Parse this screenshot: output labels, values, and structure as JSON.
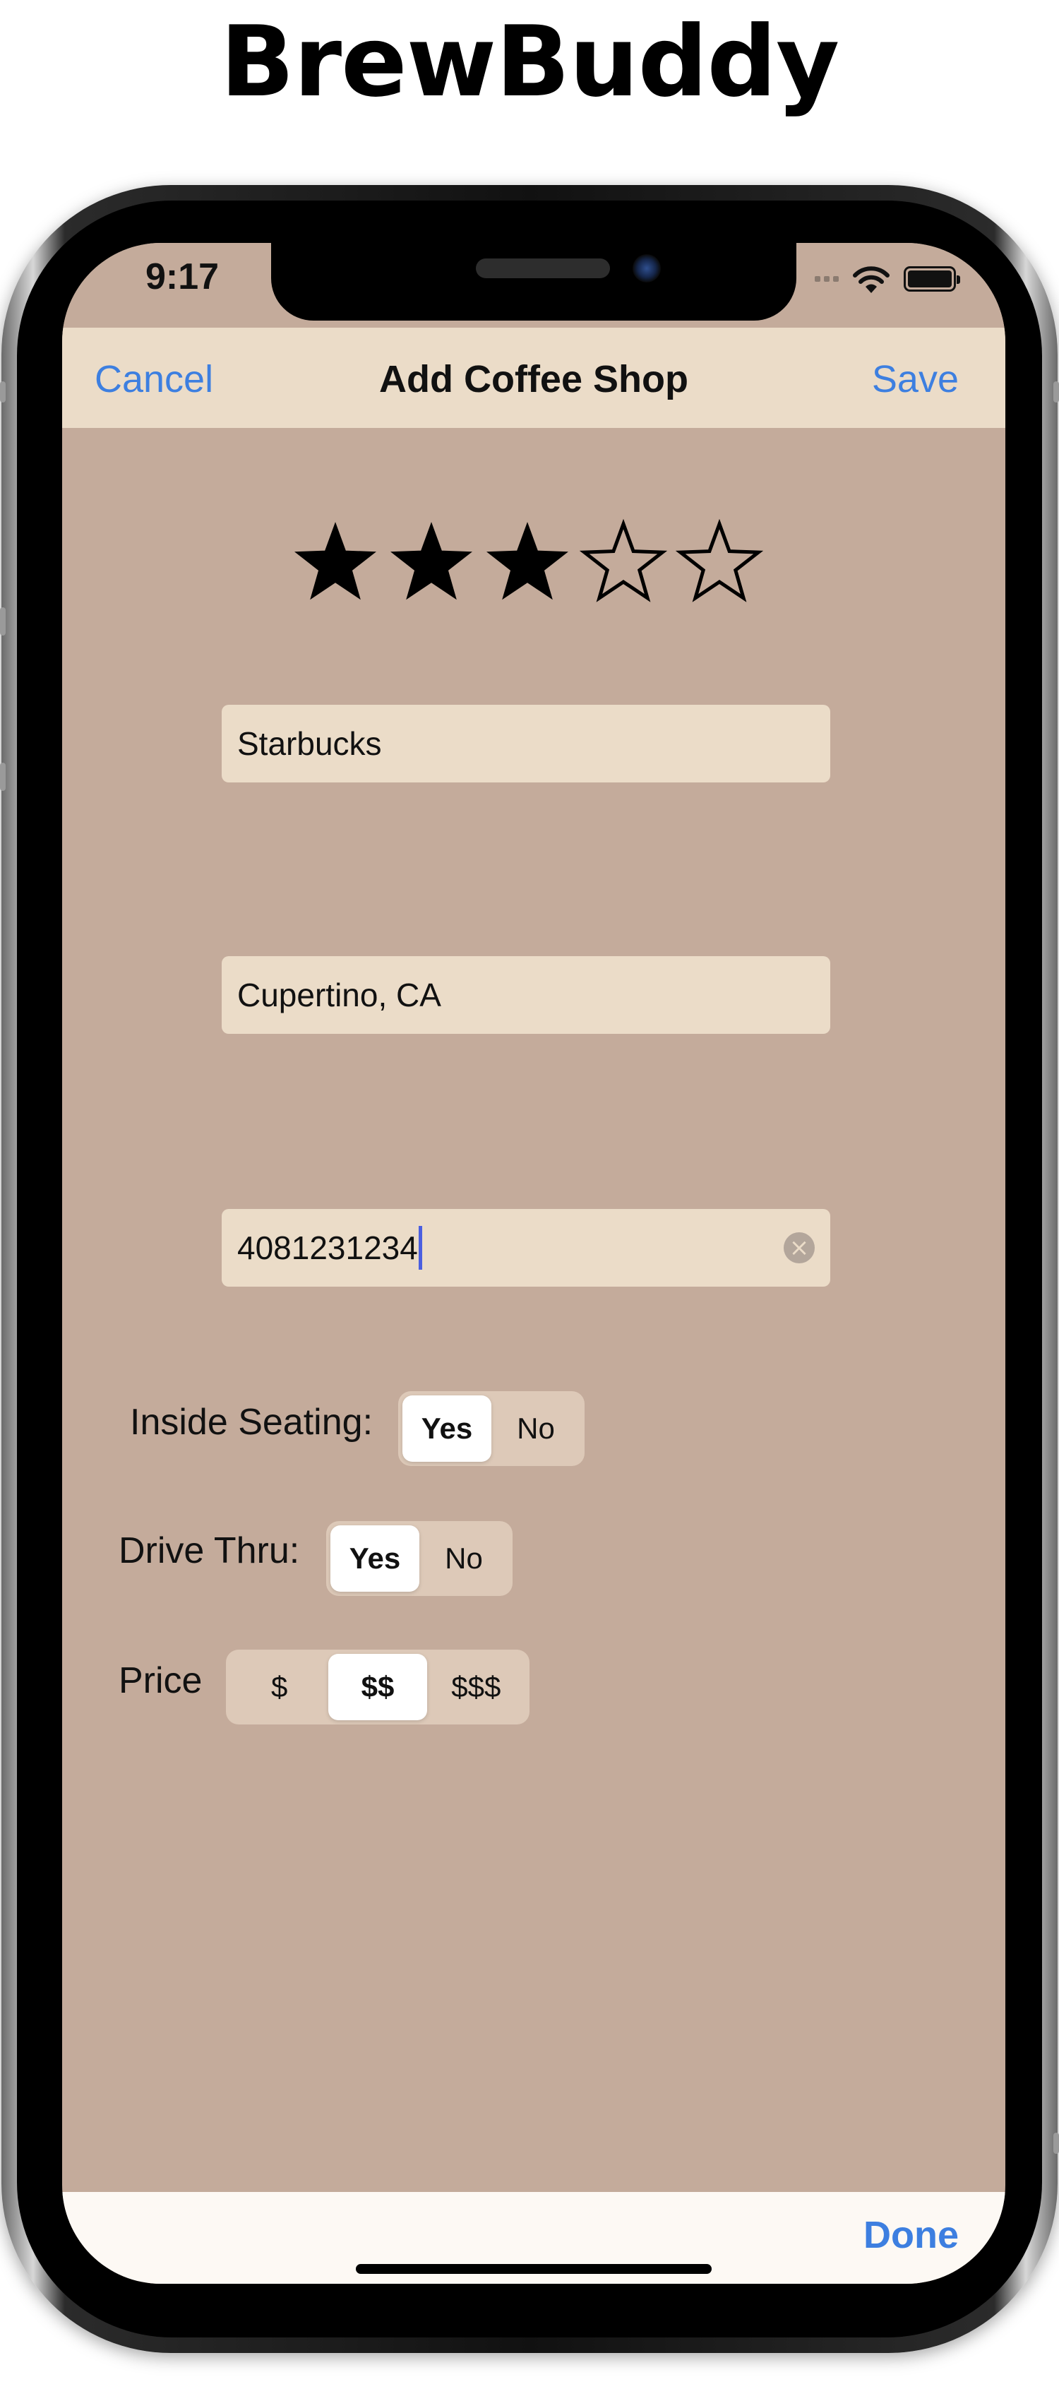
{
  "app": {
    "title": "BrewBuddy"
  },
  "status_bar": {
    "time": "9:17"
  },
  "nav": {
    "cancel_label": "Cancel",
    "title": "Add Coffee Shop",
    "save_label": "Save"
  },
  "rating": {
    "value": 3,
    "max": 5
  },
  "fields": {
    "name": "Starbucks",
    "location": "Cupertino, CA",
    "phone": "4081231234"
  },
  "inside_seating": {
    "label": "Inside Seating:",
    "options": [
      "Yes",
      "No"
    ],
    "selected": "Yes"
  },
  "drive_thru": {
    "label": "Drive Thru:",
    "options": [
      "Yes",
      "No"
    ],
    "selected": "Yes"
  },
  "price": {
    "label": "Price",
    "options": [
      "$",
      "$$",
      "$$$"
    ],
    "selected": "$$"
  },
  "keyboard_accessory": {
    "done_label": "Done"
  },
  "colors": {
    "background": "#c4ab9b",
    "nav_bar": "#ebdcc8",
    "field": "#ebdcc8",
    "accent": "#3d7fe0"
  }
}
